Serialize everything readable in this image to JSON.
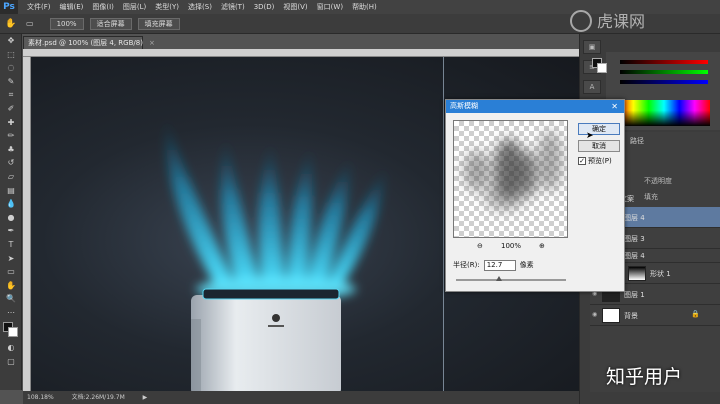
{
  "app": {
    "logo": "Ps"
  },
  "menu": [
    "文件(F)",
    "编辑(E)",
    "图像(I)",
    "图层(L)",
    "类型(Y)",
    "选择(S)",
    "滤镜(T)",
    "3D(D)",
    "视图(V)",
    "窗口(W)",
    "帮助(H)"
  ],
  "options": {
    "zoom": "100%",
    "fit_screen": "适合屏幕",
    "fill_screen": "填充屏幕"
  },
  "document_tab": {
    "title": "素材.psd @ 100% (图层 4, RGB/8)",
    "close": "×"
  },
  "status": {
    "zoom": "108.18%",
    "doc_info": "文档:2.26M/19.7M"
  },
  "dialog": {
    "title": "高斯模糊",
    "ok": "确定",
    "cancel": "取消",
    "preview_label": "预览(P)",
    "preview_checked": true,
    "zoom_percent": "100%",
    "radius_label": "半径(R):",
    "radius_value": "12.7",
    "radius_unit": "像素"
  },
  "layers": {
    "items": [
      {
        "label": "文案"
      },
      {
        "label": "图层 4",
        "selected": true
      },
      {
        "label": "图层 3"
      },
      {
        "label": "图层 4"
      },
      {
        "label": "形状 1"
      },
      {
        "label": "图层 1"
      },
      {
        "label": "背景"
      }
    ],
    "blend_mode": "不透明度",
    "fill_label": "填充"
  },
  "watermark": {
    "top_right": "虎课网",
    "bottom_right": "知乎用户"
  },
  "colors": {
    "accent": "#2a7fd6",
    "glow": "#3fd4f4",
    "selected_layer": "#5e7aa0"
  }
}
